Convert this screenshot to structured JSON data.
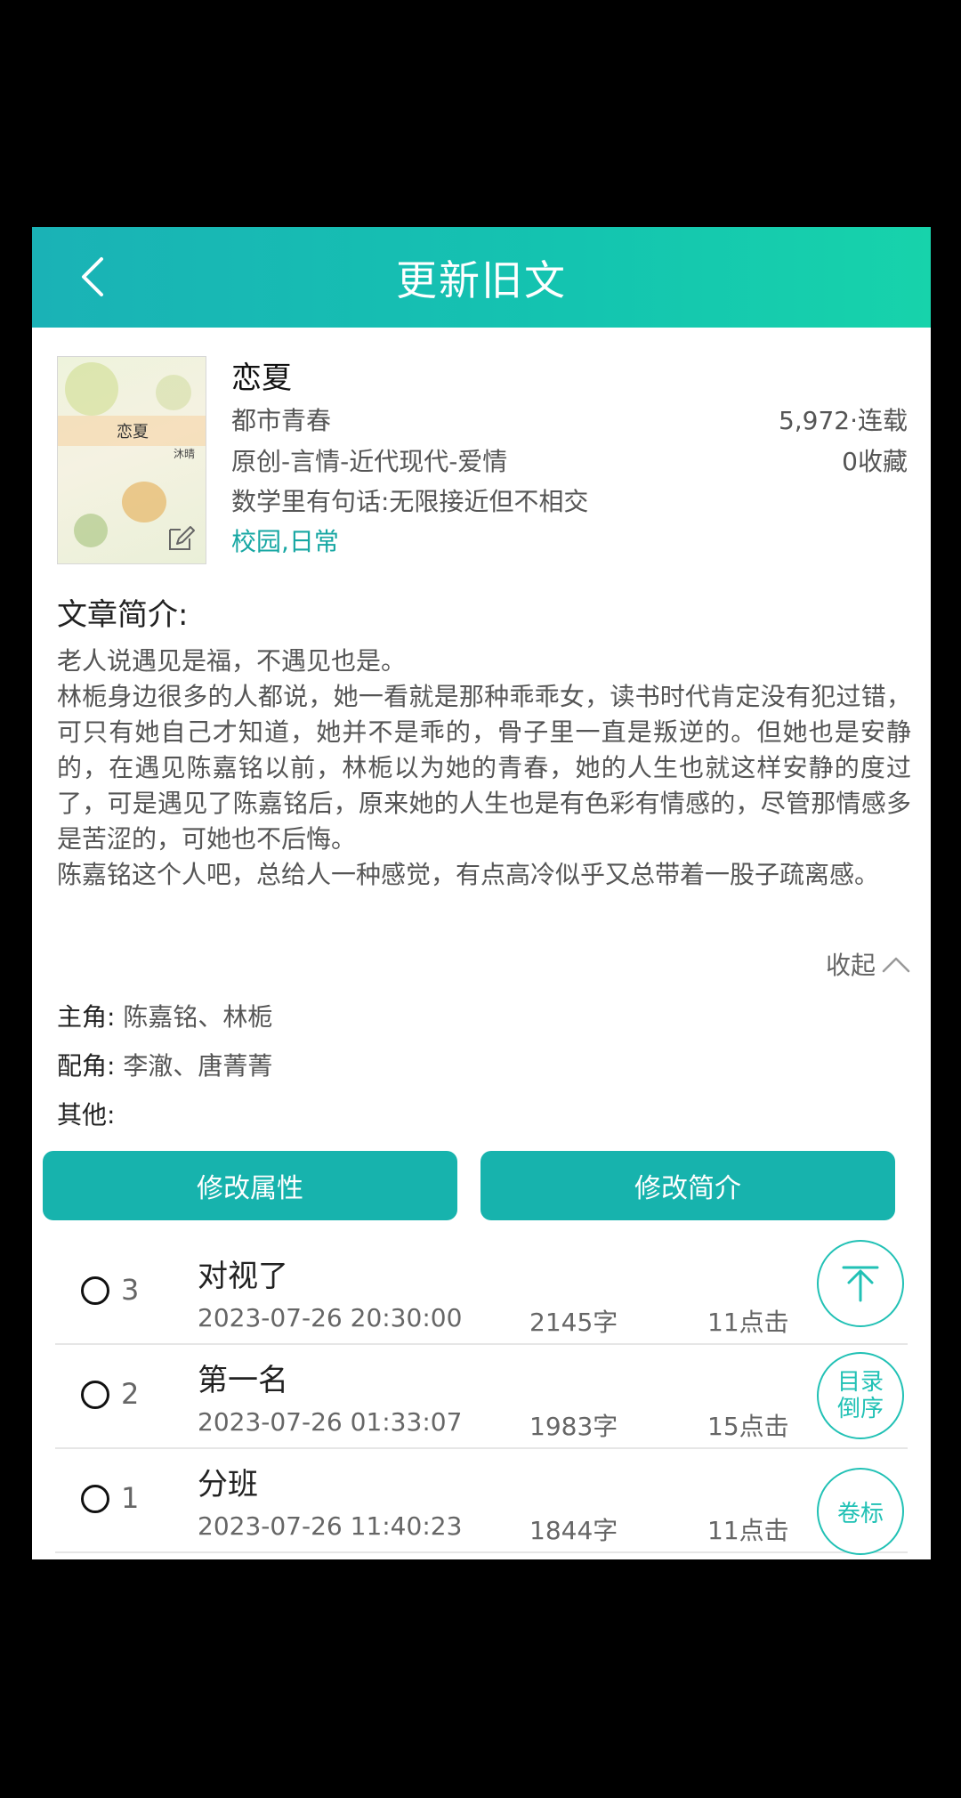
{
  "header": {
    "title": "更新旧文",
    "back_icon": "chevron-left-icon"
  },
  "book": {
    "cover_title": "恋夏",
    "cover_author": "沐晴",
    "name": "恋夏",
    "genre": "都市青春",
    "word_status": "5,972·连载",
    "category": "原创-言情-近代现代-爱情",
    "favorites": "0收藏",
    "tagline": "数学里有句话:无限接近但不相交",
    "tags": "校园,日常"
  },
  "intro": {
    "heading": "文章简介:",
    "paragraphs": [
      "老人说遇见是福，不遇见也是。",
      "林栀身边很多的人都说，她一看就是那种乖乖女，读书时代肯定没有犯过错，可只有她自己才知道，她并不是乖的，骨子里一直是叛逆的。但她也是安静的，在遇见陈嘉铭以前，林栀以为她的青春，她的人生也就这样安静的度过了，可是遇见了陈嘉铭后，原来她的人生也是有色彩有情感的，尽管那情感多是苦涩的，可她也不后悔。",
      "陈嘉铭这个人吧，总给人一种感觉，有点高冷似乎又总带着一股子疏离感。"
    ],
    "collapse_label": "收起"
  },
  "roles": {
    "lead_label": "主角:",
    "lead": "陈嘉铭、林栀",
    "support_label": "配角:",
    "support": "李澈、唐菁菁",
    "other_label": "其他:",
    "other": ""
  },
  "buttons": {
    "edit_attributes": "修改属性",
    "edit_intro": "修改简介"
  },
  "chapters": [
    {
      "number": "3",
      "title": "对视了",
      "date": "2023-07-26 20:30:00",
      "words": "2145字",
      "clicks": "11点击"
    },
    {
      "number": "2",
      "title": "第一名",
      "date": "2023-07-26 01:33:07",
      "words": "1983字",
      "clicks": "15点击"
    },
    {
      "number": "1",
      "title": "分班",
      "date": "2023-07-26 11:40:23",
      "words": "1844字",
      "clicks": "11点击"
    }
  ],
  "fabs": {
    "scroll_top_icon": "arrow-to-top-icon",
    "sort_line1": "目录",
    "sort_line2": "倒序",
    "volume": "卷标"
  },
  "colors": {
    "accent": "#17b3ad",
    "tag": "#17a7a3",
    "header_start": "#1ab2b6",
    "header_end": "#17d3ab"
  }
}
